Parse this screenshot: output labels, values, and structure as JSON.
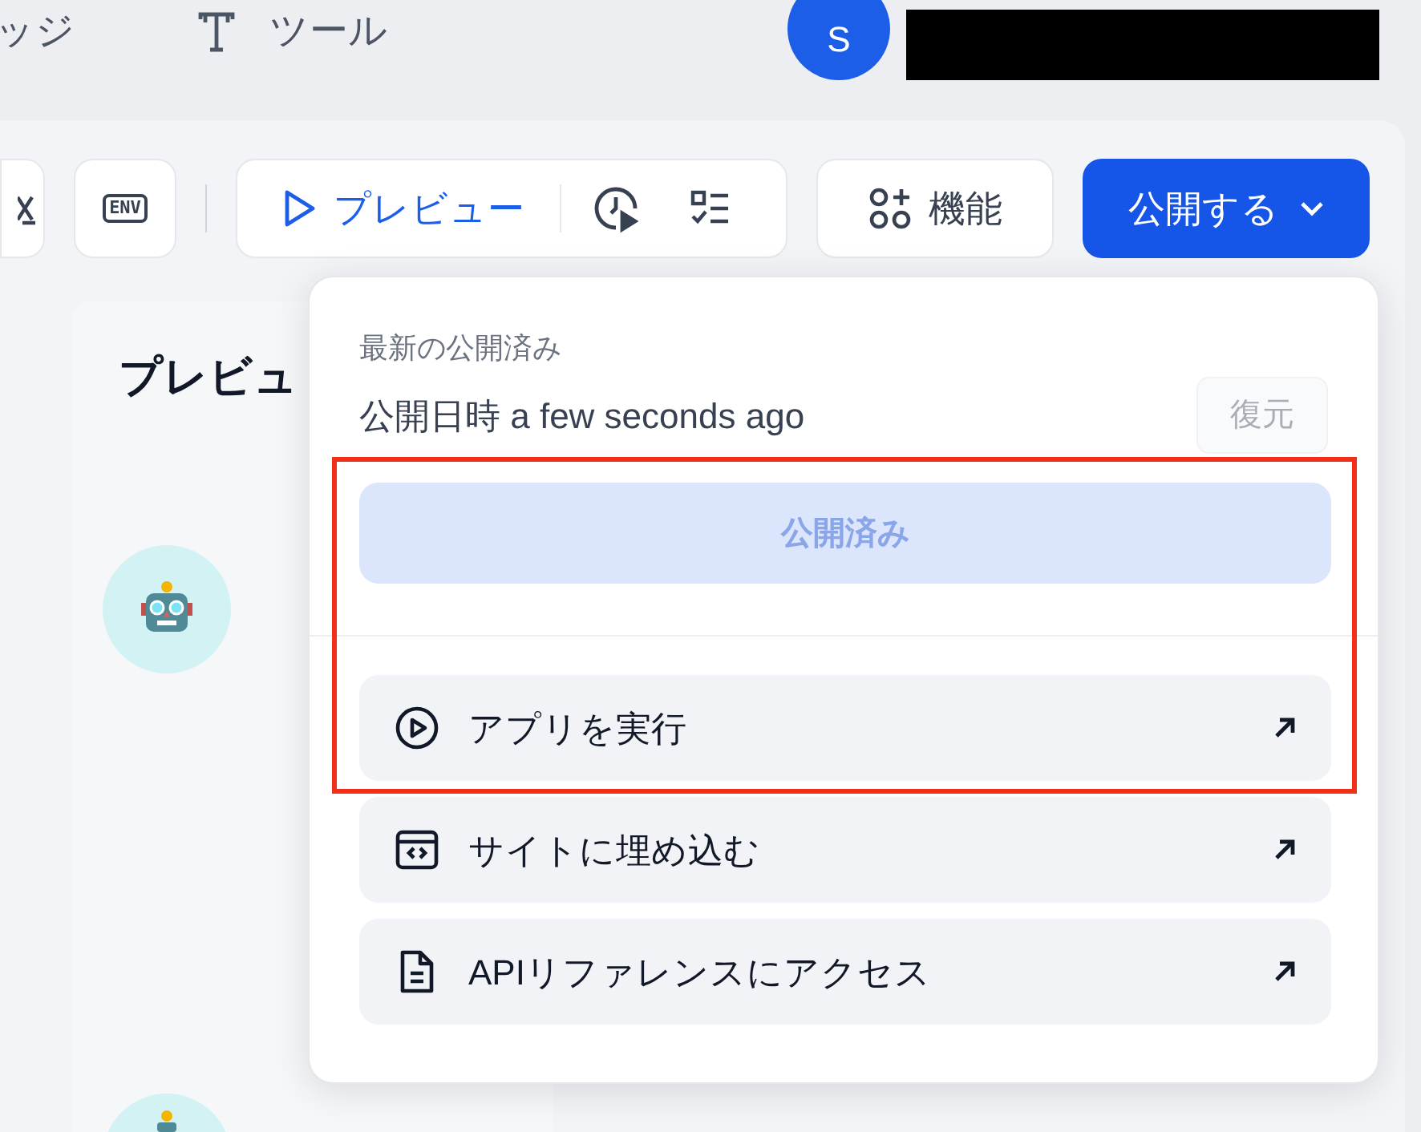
{
  "nav_tabs": [
    "ッジ",
    "ツール"
  ],
  "user": {
    "avatar_initial": "S"
  },
  "toolbar": {
    "env_label": "ENV",
    "preview_label": "プレビュー",
    "features_label": "機能",
    "publish_label": "公開する"
  },
  "preview_panel": {
    "title": "プレビュ"
  },
  "publish_menu": {
    "heading": "最新の公開済み",
    "published_time": "公開日時 a few seconds ago",
    "restore_button": {
      "label": "復元",
      "disabled": true
    },
    "publish_button": {
      "label": "公開済み",
      "disabled": true
    },
    "actions": [
      {
        "kind": "run",
        "label": "アプリを実行"
      },
      {
        "kind": "embed",
        "label": "サイトに埋め込む"
      },
      {
        "kind": "api",
        "label": "APIリファレンスにアクセス"
      }
    ]
  }
}
